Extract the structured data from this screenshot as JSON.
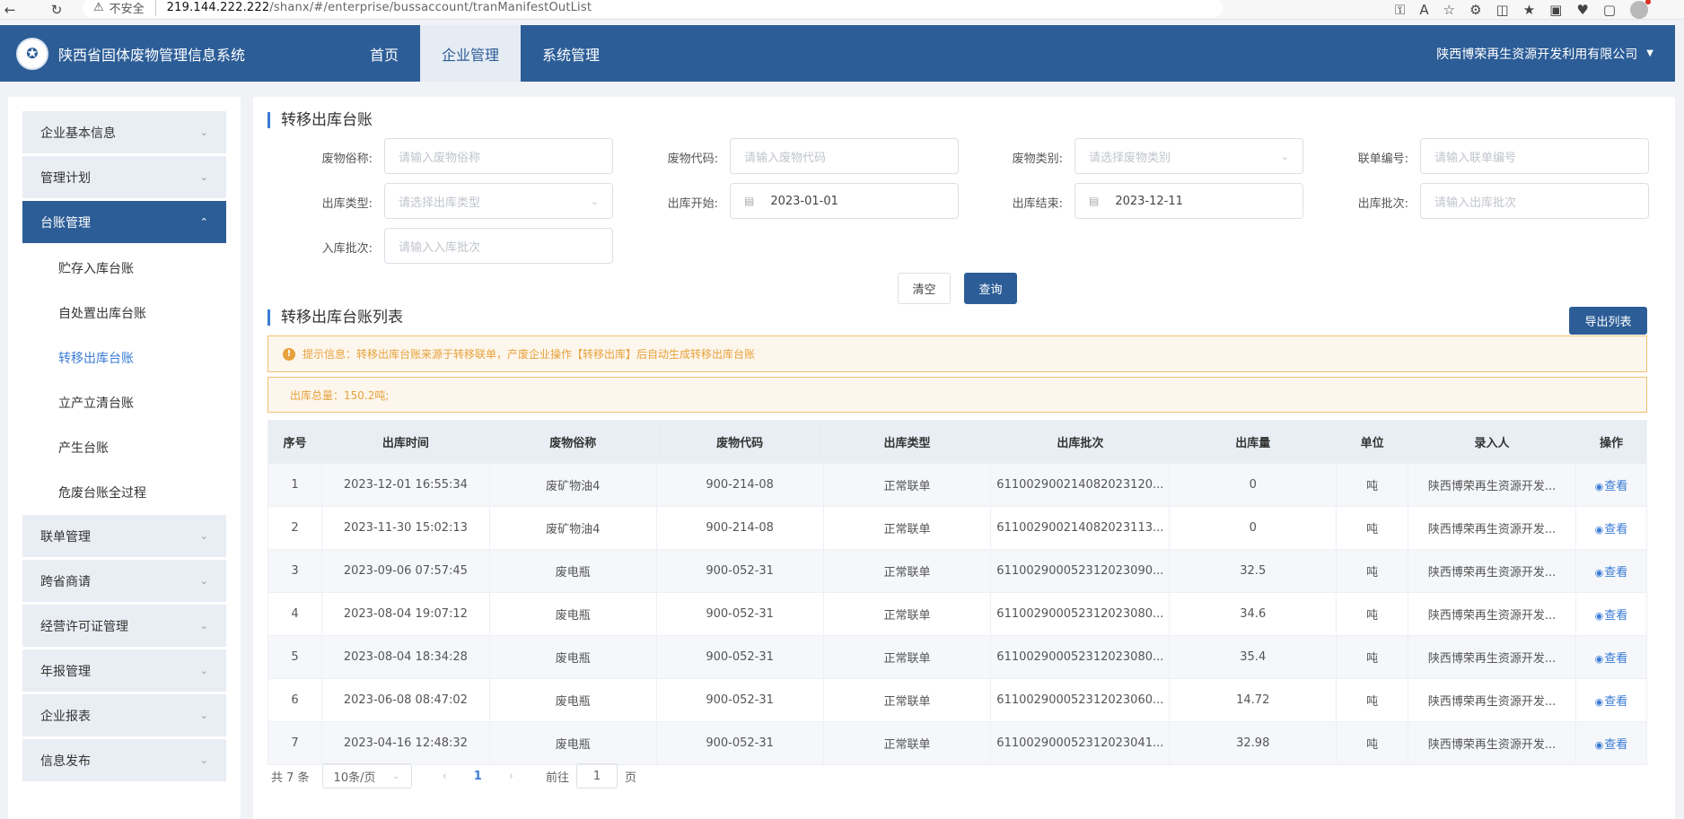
{
  "browser": {
    "insecure_label": "不安全",
    "url_host": "219.144.222.222",
    "url_path": "/shanx/#/enterprise/bussaccount/tranManifestOutList"
  },
  "topnav": {
    "system_title": "陕西省固体废物管理信息系统",
    "tabs": [
      "首页",
      "企业管理",
      "系统管理"
    ],
    "company": "陕西博荣再生资源开发利用有限公司"
  },
  "sidebar": {
    "items": [
      {
        "label": "企业基本信息"
      },
      {
        "label": "管理计划"
      },
      {
        "label": "台账管理"
      },
      {
        "label": "联单管理"
      },
      {
        "label": "跨省商请"
      },
      {
        "label": "经营许可证管理"
      },
      {
        "label": "年报管理"
      },
      {
        "label": "企业报表"
      },
      {
        "label": "信息发布"
      }
    ],
    "sub_items": [
      "贮存入库台账",
      "自处置出库台账",
      "转移出库台账",
      "立产立清台账",
      "产生台账",
      "危废台账全过程"
    ]
  },
  "search": {
    "title": "转移出库台账",
    "fields": {
      "waste_name": {
        "label": "废物俗称:",
        "placeholder": "请输入废物俗称"
      },
      "waste_code": {
        "label": "废物代码:",
        "placeholder": "请输入废物代码"
      },
      "waste_type": {
        "label": "废物类别:",
        "placeholder": "请选择废物类别"
      },
      "manifest_no": {
        "label": "联单编号:",
        "placeholder": "请输入联单编号"
      },
      "out_type": {
        "label": "出库类型:",
        "placeholder": "请选择出库类型"
      },
      "out_start": {
        "label": "出库开始:",
        "value": "2023-01-01"
      },
      "out_end": {
        "label": "出库结束:",
        "value": "2023-12-11"
      },
      "out_batch": {
        "label": "出库批次:",
        "placeholder": "请输入出库批次"
      },
      "in_batch": {
        "label": "入库批次:",
        "placeholder": "请输入入库批次"
      }
    },
    "clear_label": "清空",
    "query_label": "查询"
  },
  "list": {
    "title": "转移出库台账列表",
    "export_label": "导出列表",
    "tip": "提示信息：转移出库台账来源于转移联单，产废企业操作【转移出库】后自动生成转移出库台账",
    "total": "出库总量：150.2吨;",
    "columns": [
      "序号",
      "出库时间",
      "废物俗称",
      "废物代码",
      "出库类型",
      "出库批次",
      "出库量",
      "单位",
      "录入人",
      "操作"
    ],
    "view_label": "查看",
    "rows": [
      [
        "1",
        "2023-12-01 16:55:34",
        "废矿物油4",
        "900-214-08",
        "正常联单",
        "61100290021408202312​0...",
        "0",
        "吨",
        "陕西博荣再生资源开发..."
      ],
      [
        "2",
        "2023-11-30 15:02:13",
        "废矿物油4",
        "900-214-08",
        "正常联单",
        "61100290021408202311​3...",
        "0",
        "吨",
        "陕西博荣再生资源开发..."
      ],
      [
        "3",
        "2023-09-06 07:57:45",
        "废电瓶",
        "900-052-31",
        "正常联单",
        "61100290005231202309​0...",
        "32.5",
        "吨",
        "陕西博荣再生资源开发..."
      ],
      [
        "4",
        "2023-08-04 19:07:12",
        "废电瓶",
        "900-052-31",
        "正常联单",
        "61100290005231202308​0...",
        "34.6",
        "吨",
        "陕西博荣再生资源开发..."
      ],
      [
        "5",
        "2023-08-04 18:34:28",
        "废电瓶",
        "900-052-31",
        "正常联单",
        "61100290005231202308​0...",
        "35.4",
        "吨",
        "陕西博荣再生资源开发..."
      ],
      [
        "6",
        "2023-06-08 08:47:02",
        "废电瓶",
        "900-052-31",
        "正常联单",
        "61100290005231202306​0...",
        "14.72",
        "吨",
        "陕西博荣再生资源开发..."
      ],
      [
        "7",
        "2023-04-16 12:48:32",
        "废电瓶",
        "900-052-31",
        "正常联单",
        "61100290005231202304​1...",
        "32.98",
        "吨",
        "陕西博荣再生资源开发..."
      ]
    ]
  },
  "pager": {
    "total_text": "共 7 条",
    "page_size": "10条/页",
    "current_page": "1",
    "goto_label": "前往",
    "goto_value": "1",
    "page_suffix": "页"
  },
  "colors": {
    "nav_bg": "#2c5d97",
    "accent": "#3a7bd5",
    "warning": "#e6a23c"
  }
}
